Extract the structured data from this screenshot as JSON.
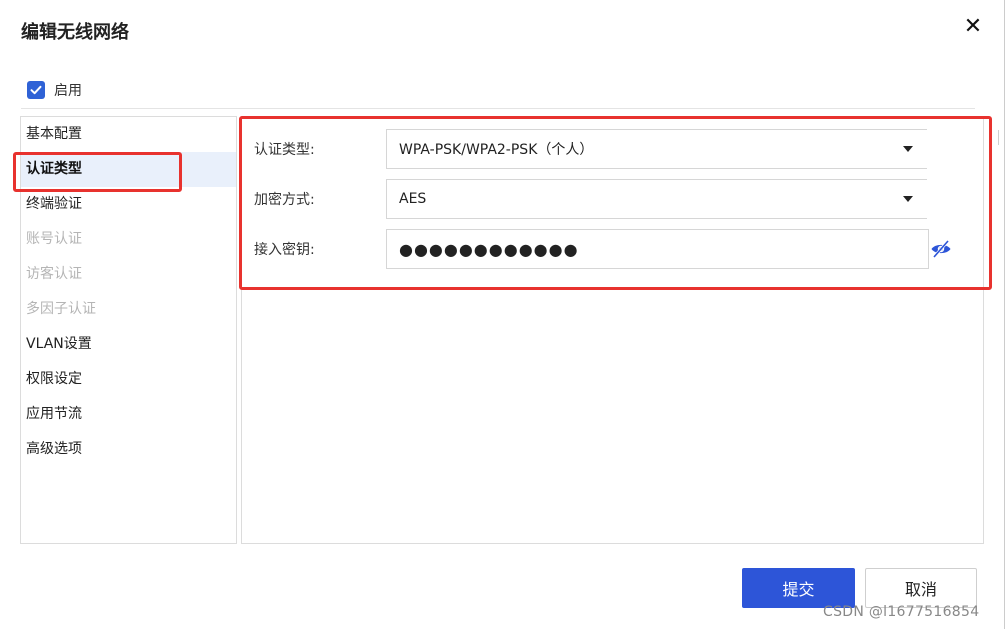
{
  "dialog": {
    "title": "编辑无线网络",
    "close_icon": "close-icon",
    "enable_label": "启用",
    "enable_checked": true
  },
  "sidebar": {
    "items": [
      {
        "label": "基本配置",
        "state": "normal"
      },
      {
        "label": "认证类型",
        "state": "active"
      },
      {
        "label": "终端验证",
        "state": "normal"
      },
      {
        "label": "账号认证",
        "state": "disabled"
      },
      {
        "label": "访客认证",
        "state": "disabled"
      },
      {
        "label": "多因子认证",
        "state": "disabled"
      },
      {
        "label": "VLAN设置",
        "state": "normal"
      },
      {
        "label": "权限设定",
        "state": "normal"
      },
      {
        "label": "应用节流",
        "state": "normal"
      },
      {
        "label": "高级选项",
        "state": "normal"
      }
    ]
  },
  "form": {
    "auth_type": {
      "label": "认证类型:",
      "value": "WPA-PSK/WPA2-PSK（个人）"
    },
    "encryption": {
      "label": "加密方式:",
      "value": "AES"
    },
    "access_key": {
      "label": "接入密钥:",
      "value": "●●●●●●●●●●●●",
      "toggle_icon": "eye-hidden-icon"
    }
  },
  "buttons": {
    "submit": "提交",
    "cancel": "取消"
  },
  "watermark": "CSDN @l1677516854",
  "colors": {
    "primary": "#2d55d8",
    "checkbox": "#2f62d6",
    "highlight_box": "#e8322e",
    "active_item_bg": "#e9f0fb",
    "disabled_text": "#b5b5b5"
  }
}
